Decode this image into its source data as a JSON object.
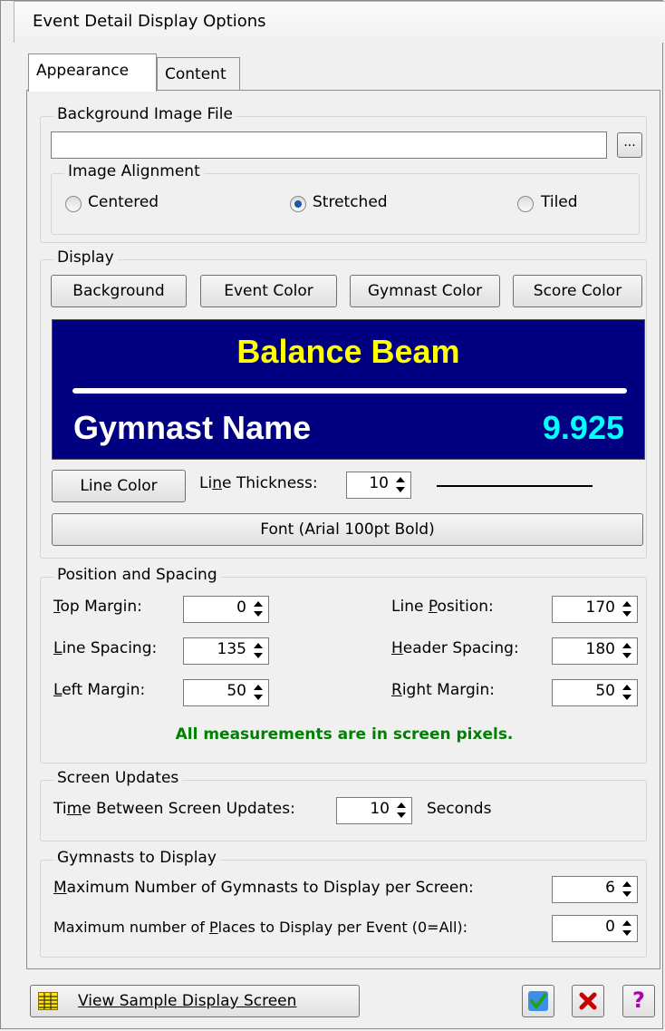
{
  "window": {
    "title": "Event Detail Display Options"
  },
  "tabs": [
    {
      "label": "Appearance",
      "active": true
    },
    {
      "label": "Content",
      "active": false
    }
  ],
  "background_image": {
    "legend": "Background Image File",
    "file_value": "",
    "browse_label": "...",
    "alignment": {
      "legend": "Image Alignment",
      "options": [
        {
          "label": "Centered",
          "selected": false
        },
        {
          "label": "Stretched",
          "selected": true
        },
        {
          "label": "Tiled",
          "selected": false
        }
      ]
    }
  },
  "display": {
    "legend": "Display",
    "buttons": [
      "Background",
      "Event Color",
      "Gymnast Color",
      "Score Color"
    ],
    "preview": {
      "event": "Balance Beam",
      "gymnast": "Gymnast Name",
      "score": "9.925",
      "bg_color": "#000080",
      "event_color": "#ffff00",
      "gymnast_color": "#ffffff",
      "score_color": "#00ffff"
    },
    "line_color_label": "Line Color",
    "line_thickness_label": "Line Thickness:",
    "line_thickness_value": "10",
    "font_label": "Font  (Arial 100pt Bold)"
  },
  "position": {
    "legend": "Position and Spacing",
    "fields": {
      "top_margin": {
        "label": "Top Margin:",
        "value": "0"
      },
      "line_spacing": {
        "label": "Line Spacing:",
        "value": "135"
      },
      "left_margin": {
        "label": "Left Margin:",
        "value": "50"
      },
      "line_position": {
        "label": "Line Position:",
        "value": "170"
      },
      "header_spacing": {
        "label": "Header Spacing:",
        "value": "180"
      },
      "right_margin": {
        "label": "Right Margin:",
        "value": "50"
      }
    },
    "note": "All measurements are in screen pixels.",
    "note_color": "#008000"
  },
  "updates": {
    "legend": "Screen Updates",
    "label": "Time Between Screen Updates:",
    "value": "10",
    "unit": "Seconds"
  },
  "gymnasts": {
    "legend": "Gymnasts to Display",
    "max_gymnasts_label": "Maximum Number of Gymnasts to Display per Screen:",
    "max_gymnasts_value": "6",
    "max_places_label": "Maximum number of Places to Display per Event (0=All):",
    "max_places_value": "0"
  },
  "footer": {
    "view_sample_label": "View Sample Display Screen",
    "ok_icon": "green-checkmark-icon",
    "cancel_icon": "red-x-icon",
    "help_icon": "question-mark-icon"
  }
}
